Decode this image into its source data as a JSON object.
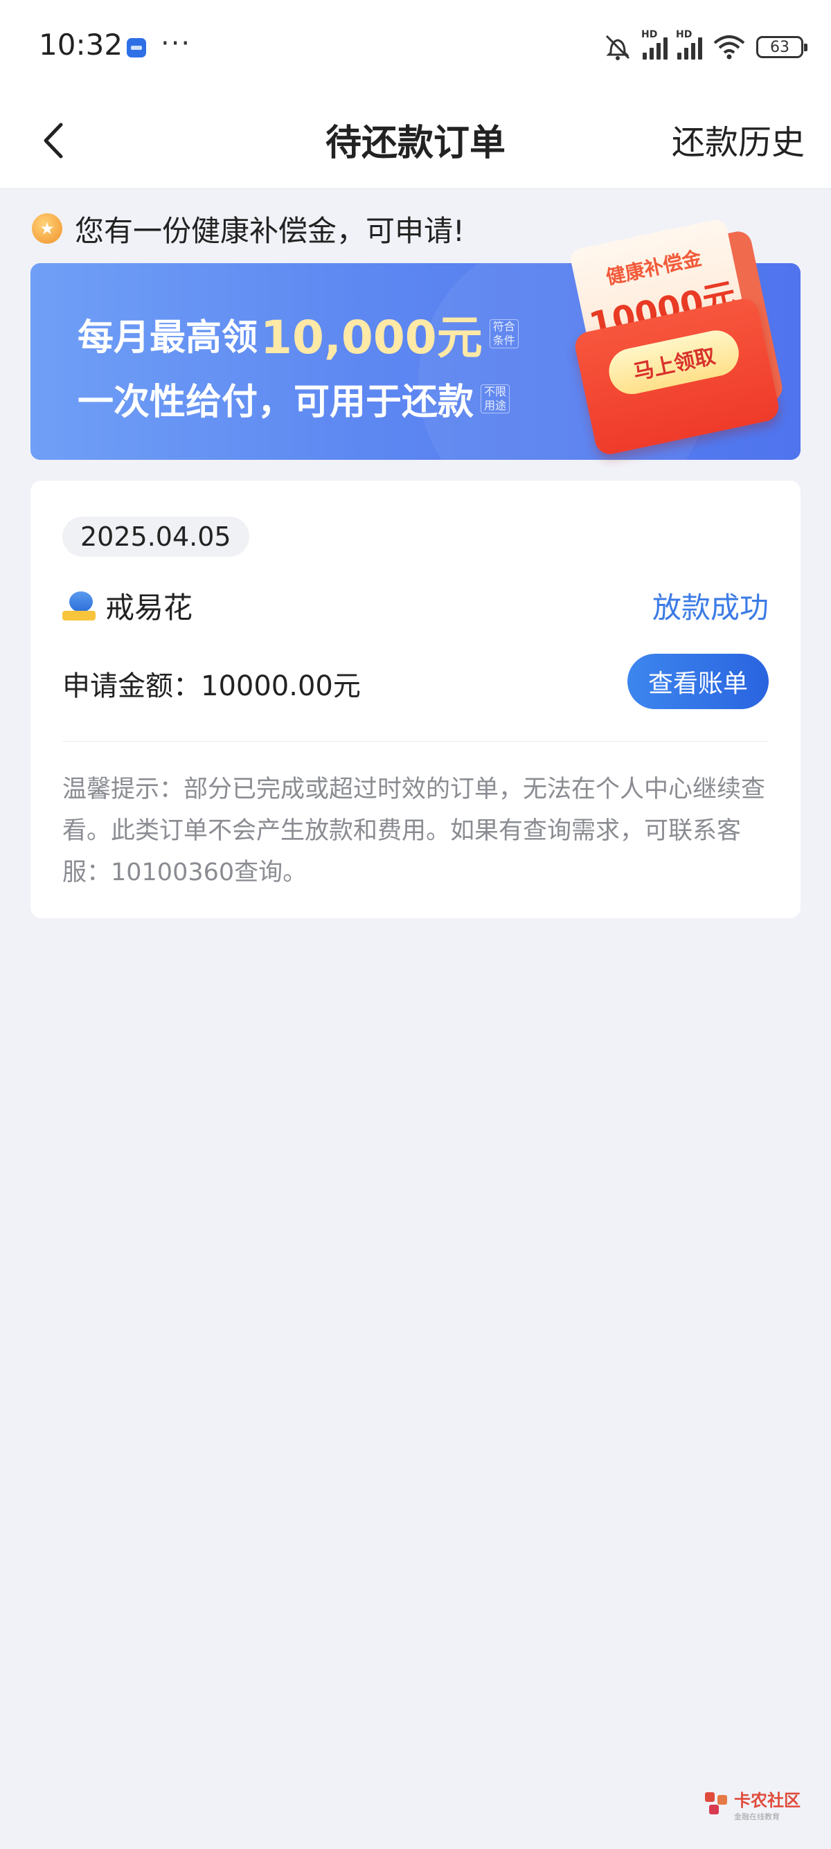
{
  "status_bar": {
    "time": "10:32",
    "dots": "···",
    "hd": "HD",
    "battery": "63"
  },
  "header": {
    "title": "待还款订单",
    "history": "还款历史"
  },
  "notice": {
    "text": "您有一份健康补偿金，可申请!"
  },
  "banner": {
    "line1_prefix": "每月最高领",
    "amount": "10,000元",
    "tag1": "符合条件",
    "line2": "一次性给付，可用于还款",
    "tag2": "不限用途",
    "envelope_title": "健康补偿金",
    "envelope_amount": "10000元",
    "envelope_button": "马上领取"
  },
  "order": {
    "date": "2025.04.05",
    "product_name": "戒易花",
    "status": "放款成功",
    "amount_label": "申请金额：10000.00元",
    "view_button": "查看账单",
    "tip": "温馨提示：部分已完成或超过时效的订单，无法在个人中心继续查看。此类订单不会产生放款和费用。如果有查询需求，可联系客服：10100360查询。"
  },
  "watermark": {
    "name": "卡农社区",
    "sub": "金融在线教育"
  },
  "colors": {
    "accent": "#3b7be6",
    "page_bg": "#f1f2f8",
    "banner": "#5d87f1",
    "envelope": "#ef3b2a"
  }
}
